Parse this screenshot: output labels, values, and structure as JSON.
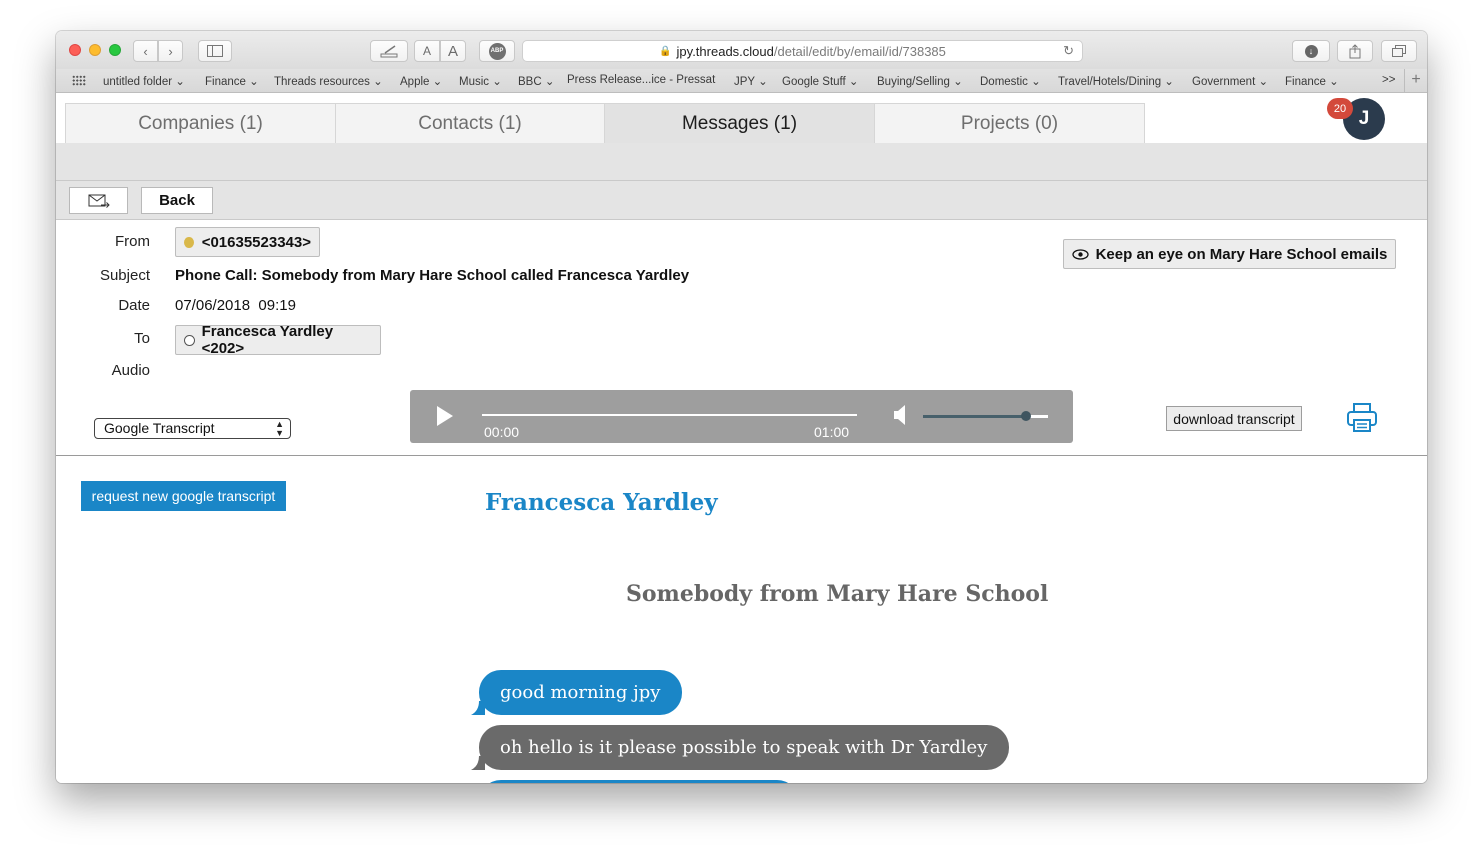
{
  "browser": {
    "url_host": "jpy.threads.cloud",
    "url_path": "/detail/edit/by/email/id/738385",
    "font_size_small": "A",
    "font_size_large": "A",
    "adblock": "ABP"
  },
  "bookmarks": [
    "untitled folder ⌄",
    "Finance ⌄",
    "Threads resources ⌄",
    "Apple ⌄",
    "Music ⌄",
    "BBC ⌄",
    "Press Release...ice - Pressat",
    "JPY ⌄",
    "Google Stuff ⌄",
    "Buying/Selling ⌄",
    "Domestic ⌄",
    "Travel/Hotels/Dining ⌄",
    "Government ⌄",
    "Finance ⌄",
    ">>"
  ],
  "tabs": [
    "Companies  (1)",
    "Contacts  (1)",
    "Messages (1)",
    "Projects  (0)"
  ],
  "user": {
    "initial": "J",
    "notifications": "20"
  },
  "actions": {
    "back": "Back"
  },
  "message": {
    "from_label": "From",
    "from_value": "<01635523343>",
    "subject_label": "Subject",
    "subject_value": "Phone Call: Somebody from Mary Hare School called Francesca Yardley",
    "date_label": "Date",
    "date_value": "07/06/2018  09:19",
    "to_label": "To",
    "to_value": "Francesca Yardley <202>",
    "audio_label": "Audio",
    "watch_label": "Keep an eye on Mary Hare School emails"
  },
  "player": {
    "current": "00:00",
    "duration": "01:00",
    "volume": 0.82
  },
  "transcript": {
    "source_selected": "Google Transcript",
    "download_label": "download transcript",
    "request_label": "request new google transcript",
    "recipient_name": "Francesca Yardley",
    "caller_name": "Somebody from Mary Hare School",
    "messages": [
      {
        "speaker": "recipient",
        "text": "good morning jpy"
      },
      {
        "speaker": "caller",
        "text": "oh hello is it please possible to speak with Dr Yardley"
      }
    ]
  },
  "colors": {
    "accent": "#1a86c7",
    "caller_bubble": "#6a6a6a",
    "notification": "#d3493b"
  }
}
